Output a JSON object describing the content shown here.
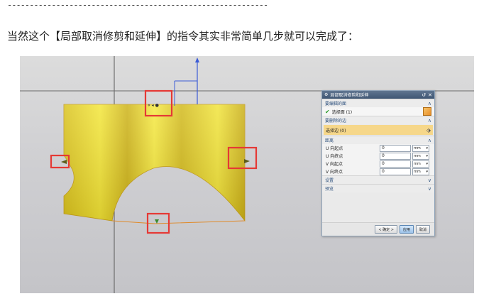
{
  "separator": "-----------------------------------------------------------",
  "caption": "当然这个【局部取消修剪和延伸】的指令其实非常简单几步就可以完成了：",
  "dialog": {
    "title": "局部取消修剪和延伸",
    "sections": {
      "face": {
        "label": "要编辑的面",
        "value": "选择面 (1)"
      },
      "edge": {
        "label": "要删除的边",
        "value": "选择边 (0)"
      },
      "distance": {
        "label": "距离",
        "fields": [
          {
            "label": "U 向起点",
            "value": "0",
            "unit": "mm"
          },
          {
            "label": "U 向终点",
            "value": "0",
            "unit": "mm"
          },
          {
            "label": "V 向起点",
            "value": "0",
            "unit": "mm"
          },
          {
            "label": "V 向终点",
            "value": "0",
            "unit": "mm"
          }
        ]
      },
      "settings": {
        "label": "设置"
      },
      "preview": {
        "label": "预览"
      }
    },
    "buttons": {
      "ok": "< 确定 >",
      "apply": "应用",
      "cancel": "取消"
    }
  },
  "colors": {
    "surface": "#e8d832",
    "highlight": "#e53935",
    "dialog_title": "#4a6080",
    "axis": "#3b5bd6"
  }
}
